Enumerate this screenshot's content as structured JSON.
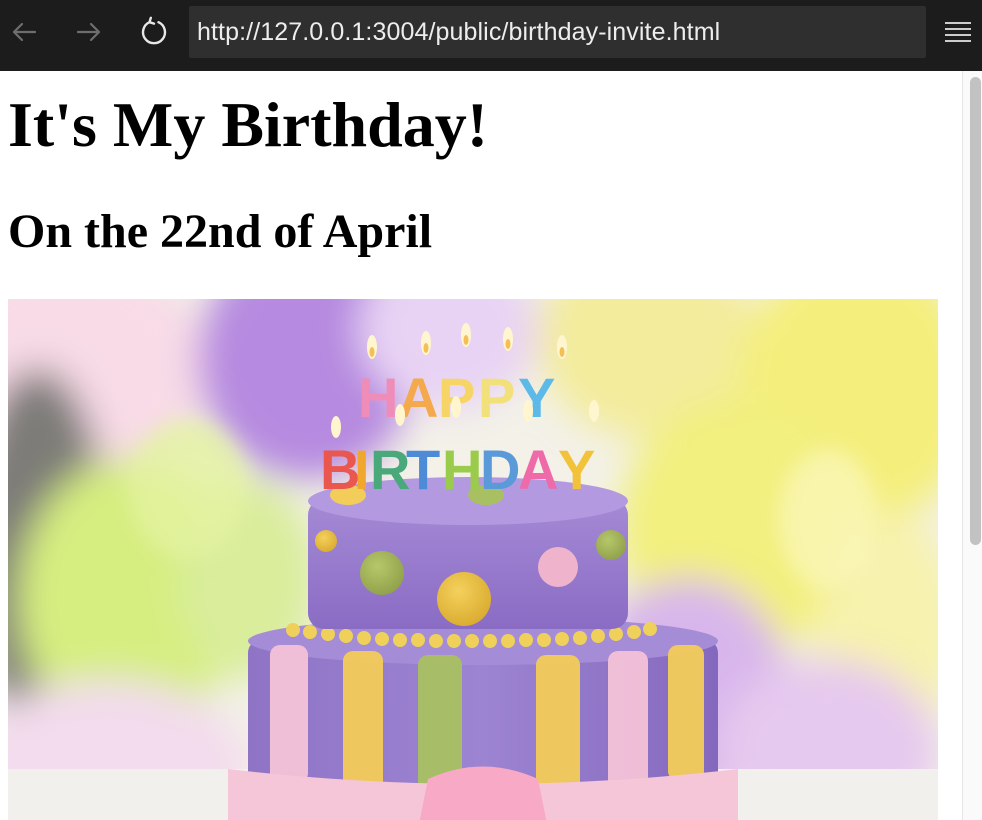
{
  "browser": {
    "url": "http://127.0.0.1:3004/public/birthday-invite.html",
    "icons": {
      "back": "arrow-left-icon",
      "forward": "arrow-right-icon",
      "reload": "reload-icon",
      "menu": "hamburger-menu-icon"
    },
    "colors": {
      "toolbar": "#1c1c1c",
      "url_bar": "#2f2f2f",
      "url_text": "#ededed"
    }
  },
  "page": {
    "title": "It's My Birthday!",
    "subtitle": "On the 22nd of April",
    "image": {
      "candles_text_top": "HAPPY",
      "candles_text_bottom": "BIRTHDAY"
    }
  }
}
